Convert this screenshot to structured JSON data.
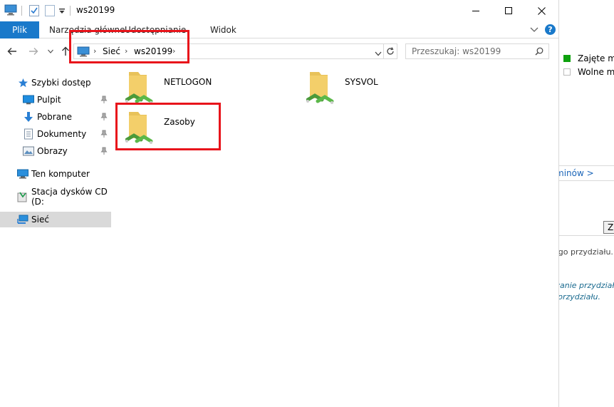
{
  "window": {
    "title": "ws20199"
  },
  "ribbon": {
    "tabs": [
      {
        "label": "Plik"
      },
      {
        "label": "Narzędzia główne"
      },
      {
        "label": "Udostępnianie"
      },
      {
        "label": "Widok"
      }
    ],
    "help_label": "?"
  },
  "address": {
    "crumbs": [
      "Sieć",
      "ws20199"
    ]
  },
  "search": {
    "placeholder": "Przeszukaj: ws20199"
  },
  "nav": {
    "quick_access": "Szybki dostęp",
    "pinned": [
      {
        "label": "Pulpit",
        "icon": "desktop-icon"
      },
      {
        "label": "Pobrane",
        "icon": "download-icon"
      },
      {
        "label": "Dokumenty",
        "icon": "documents-icon"
      },
      {
        "label": "Obrazy",
        "icon": "pictures-icon"
      }
    ],
    "this_pc": "Ten komputer",
    "cd_drive": "Stacja dysków CD (D:",
    "network": "Sieć"
  },
  "items": [
    {
      "name": "NETLOGON"
    },
    {
      "name": "SYSVOL"
    },
    {
      "name": "Zasoby"
    }
  ],
  "background": {
    "legend_used": "Zajęte mie",
    "legend_free": "Wolne mie",
    "link": "minów >",
    "btn": "Z",
    "text1": "ego przydziału.",
    "text2": "wanie przydział",
    "text3": "przydziału.",
    "used_color": "#0ea10e"
  },
  "colors": {
    "accent": "#1979ca",
    "highlight": "#e8141b",
    "selected": "#d9d9d9"
  }
}
